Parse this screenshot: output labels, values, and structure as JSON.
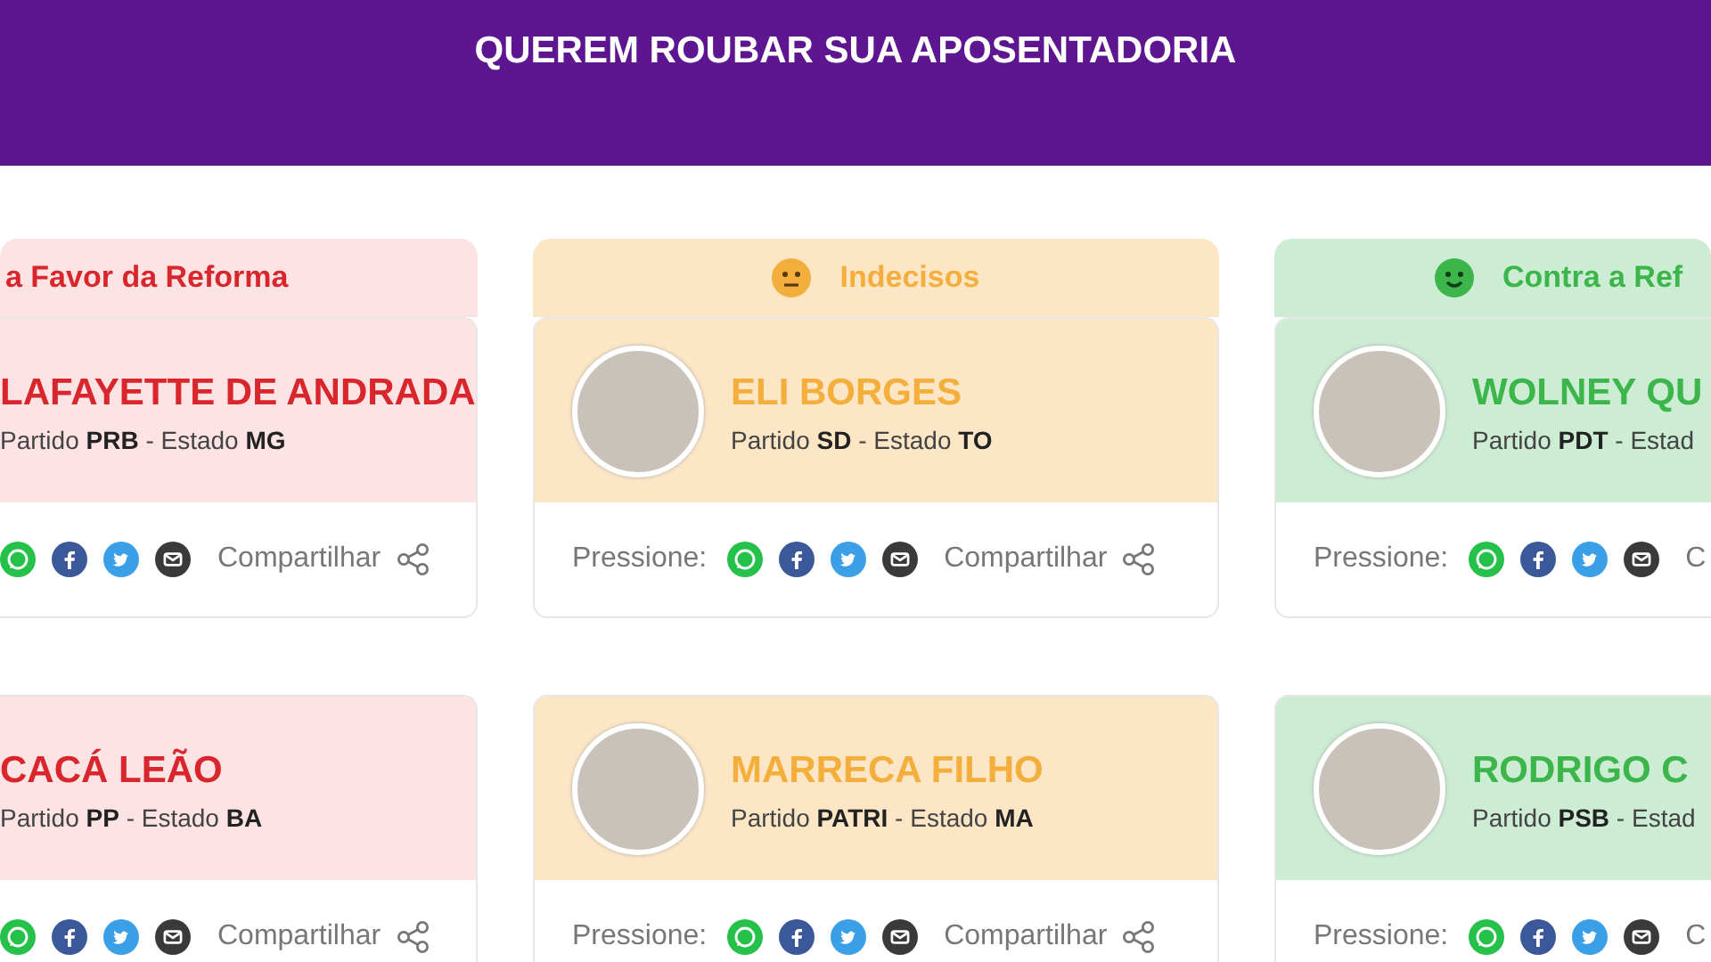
{
  "banner": {
    "title": "QUEREM ROUBAR SUA APOSENTADORIA"
  },
  "columns": [
    {
      "kind": "favor",
      "header": {
        "title": "a Favor da Reforma"
      },
      "cards": [
        {
          "name": "LAFAYETTE DE ANDRADA",
          "info": "Partido **PRB** - Estado **MG**",
          "photo": false,
          "share": "Compartilhar"
        },
        {
          "name": "CACÁ LEÃO",
          "info": "Partido **PP** - Estado **BA**",
          "photo": false,
          "share": "Compartilhar"
        }
      ]
    },
    {
      "kind": "undecided",
      "header": {
        "title": "Indecisos"
      },
      "cards": [
        {
          "name": "ELI BORGES",
          "info": "Partido **SD** - Estado **TO**",
          "photo": true,
          "press_label": "Pressione:",
          "share": "Compartilhar"
        },
        {
          "name": "MARRECA FILHO",
          "info": "Partido **PATRI** - Estado **MA**",
          "photo": true,
          "press_label": "Pressione:",
          "share": "Compartilhar"
        }
      ]
    },
    {
      "kind": "against",
      "header": {
        "title": "Contra a Ref"
      },
      "cards": [
        {
          "name": "WOLNEY QU",
          "info": "Partido **PDT** - Estad",
          "photo": true,
          "press_label": "Pressione:",
          "share": "C"
        },
        {
          "name": "RODRIGO C",
          "info": "Partido **PSB** - Estad",
          "photo": true,
          "press_label": "Pressione:",
          "share": "C"
        }
      ]
    }
  ]
}
